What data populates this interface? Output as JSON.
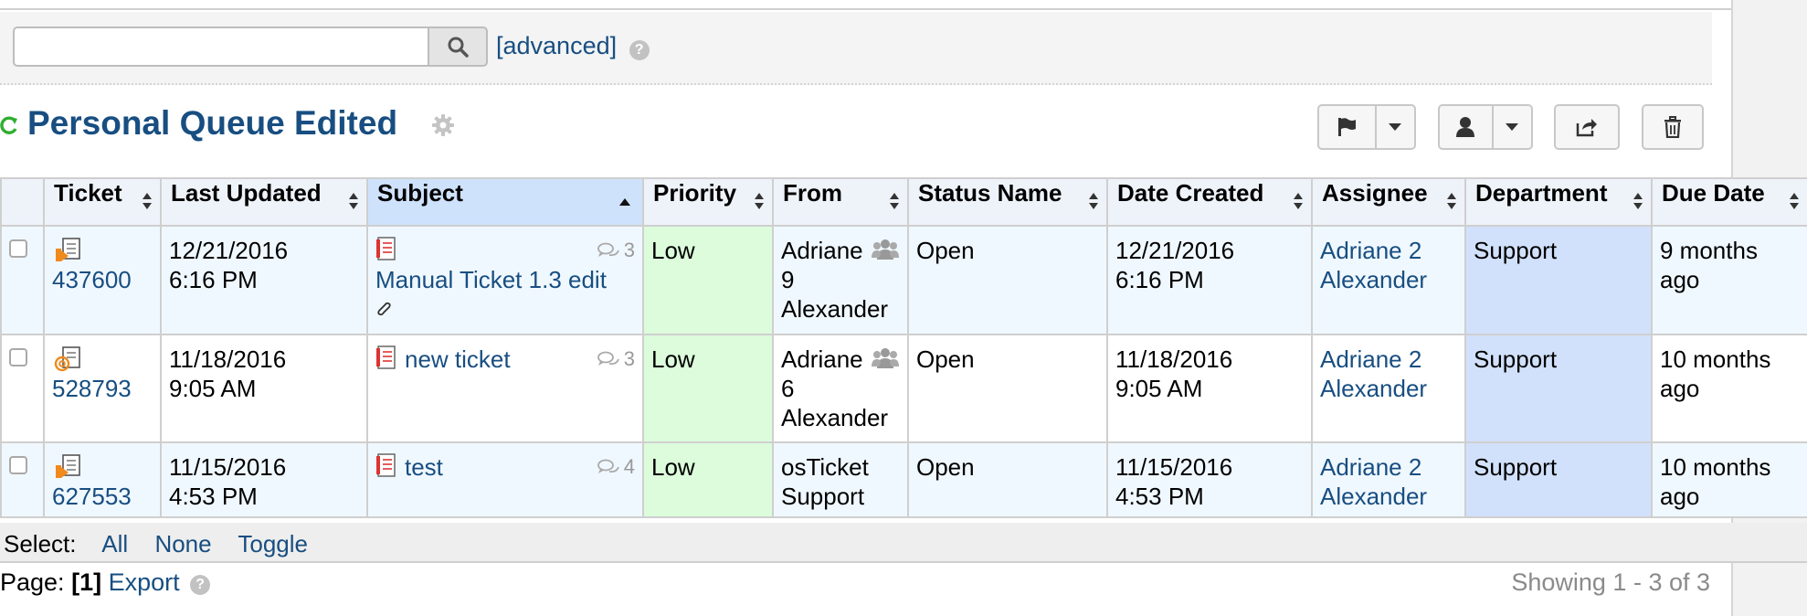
{
  "search": {
    "value": "",
    "advanced_label": "[advanced]"
  },
  "queue": {
    "title": "Personal Queue Edited"
  },
  "columns": [
    "Ticket",
    "Last Updated",
    "Subject",
    "Priority",
    "From",
    "Status Name",
    "Date Created",
    "Assignee",
    "Department",
    "Due Date"
  ],
  "rows": [
    {
      "ticket": "437600",
      "last_updated_date": "12/21/2016",
      "last_updated_time": "6:16 PM",
      "subject": "Manual Ticket 1.3 edit",
      "thread_count": "3",
      "has_attachment": true,
      "priority": "Low",
      "from_line1": "Adriane",
      "from_line2": "9",
      "from_line3": "Alexander",
      "status": "Open",
      "created_date": "12/21/2016",
      "created_time": "6:16 PM",
      "assignee_line1": "Adriane 2",
      "assignee_line2": "Alexander",
      "department": "Support",
      "due_line1": "9 months",
      "due_line2": "ago"
    },
    {
      "ticket": "528793",
      "last_updated_date": "11/18/2016",
      "last_updated_time": "9:05 AM",
      "subject": "new ticket",
      "thread_count": "3",
      "has_attachment": false,
      "priority": "Low",
      "from_line1": "Adriane",
      "from_line2": "6",
      "from_line3": "Alexander",
      "status": "Open",
      "created_date": "11/18/2016",
      "created_time": "9:05 AM",
      "assignee_line1": "Adriane 2",
      "assignee_line2": "Alexander",
      "department": "Support",
      "due_line1": "10 months",
      "due_line2": "ago"
    },
    {
      "ticket": "627553",
      "last_updated_date": "11/15/2016",
      "last_updated_time": "4:53 PM",
      "subject": "test",
      "thread_count": "4",
      "has_attachment": false,
      "priority": "Low",
      "from_line1": "osTicket",
      "from_line2": "Support",
      "from_line3": "",
      "status": "Open",
      "created_date": "11/15/2016",
      "created_time": "4:53 PM",
      "assignee_line1": "Adriane 2",
      "assignee_line2": "Alexander",
      "department": "Support",
      "due_line1": "10 months",
      "due_line2": "ago"
    }
  ],
  "select_bar": {
    "label": "Select:",
    "all": "All",
    "none": "None",
    "toggle": "Toggle"
  },
  "footer": {
    "page_label": "Page:",
    "page_current": "[1]",
    "export_label": "Export",
    "showing": "Showing 1 - 3 of 3"
  },
  "icons": {
    "search": "search-icon",
    "help": "help-icon",
    "refresh": "refresh-icon",
    "settings": "gear-icon",
    "flag": "flag-icon",
    "user": "user-icon",
    "share": "share-icon",
    "trash": "trash-icon"
  },
  "colors": {
    "link": "#184e81",
    "priority_bg": "#dcfcdc",
    "department_bg": "#d2e1fb",
    "sorted_header_bg": "#cfe2fc",
    "refresh": "#2fae2f"
  }
}
